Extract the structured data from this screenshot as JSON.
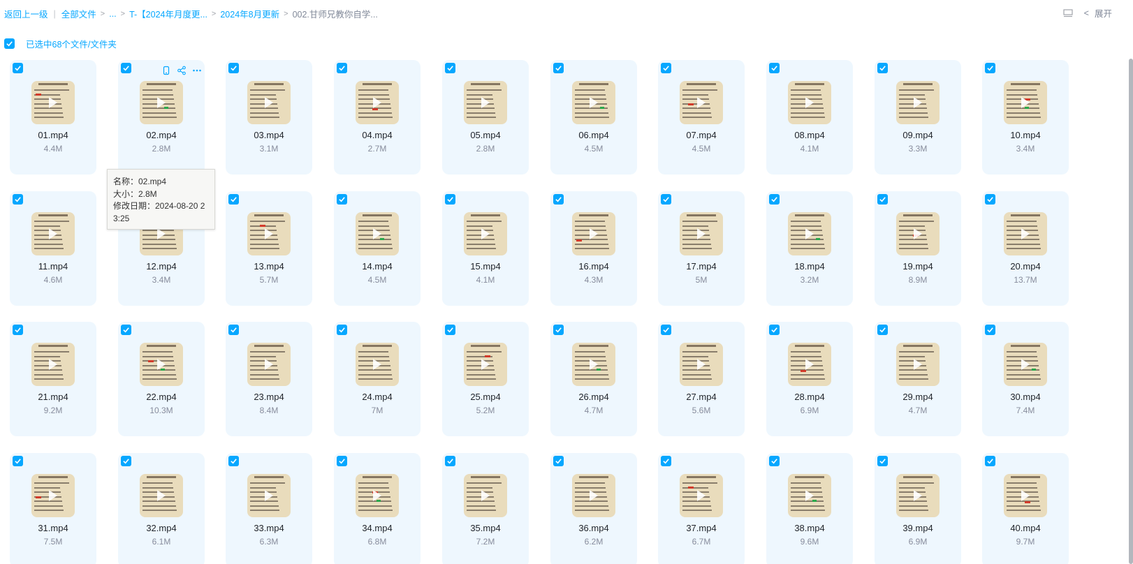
{
  "breadcrumb": {
    "back": "返回上一级",
    "items": [
      "全部文件",
      "...",
      "T-【2024年月度更...",
      "2024年8月更新",
      "002.甘师兄教你自学..."
    ]
  },
  "toolbar": {
    "expand_label": "展开"
  },
  "selection": {
    "label": "已选中68个文件/文件夹",
    "checked": true
  },
  "files": [
    {
      "name": "01.mp4",
      "size": "4.4M"
    },
    {
      "name": "02.mp4",
      "size": "2.8M"
    },
    {
      "name": "03.mp4",
      "size": "3.1M"
    },
    {
      "name": "04.mp4",
      "size": "2.7M"
    },
    {
      "name": "05.mp4",
      "size": "2.8M"
    },
    {
      "name": "06.mp4",
      "size": "4.5M"
    },
    {
      "name": "07.mp4",
      "size": "4.5M"
    },
    {
      "name": "08.mp4",
      "size": "4.1M"
    },
    {
      "name": "09.mp4",
      "size": "3.3M"
    },
    {
      "name": "10.mp4",
      "size": "3.4M"
    },
    {
      "name": "11.mp4",
      "size": "4.6M"
    },
    {
      "name": "12.mp4",
      "size": "3.4M"
    },
    {
      "name": "13.mp4",
      "size": "5.7M"
    },
    {
      "name": "14.mp4",
      "size": "4.5M"
    },
    {
      "name": "15.mp4",
      "size": "4.1M"
    },
    {
      "name": "16.mp4",
      "size": "4.3M"
    },
    {
      "name": "17.mp4",
      "size": "5M"
    },
    {
      "name": "18.mp4",
      "size": "3.2M"
    },
    {
      "name": "19.mp4",
      "size": "8.9M"
    },
    {
      "name": "20.mp4",
      "size": "13.7M"
    },
    {
      "name": "21.mp4",
      "size": "9.2M"
    },
    {
      "name": "22.mp4",
      "size": "10.3M"
    },
    {
      "name": "23.mp4",
      "size": "8.4M"
    },
    {
      "name": "24.mp4",
      "size": "7M"
    },
    {
      "name": "25.mp4",
      "size": "5.2M"
    },
    {
      "name": "26.mp4",
      "size": "4.7M"
    },
    {
      "name": "27.mp4",
      "size": "5.6M"
    },
    {
      "name": "28.mp4",
      "size": "6.9M"
    },
    {
      "name": "29.mp4",
      "size": "4.7M"
    },
    {
      "name": "30.mp4",
      "size": "7.4M"
    },
    {
      "name": "31.mp4",
      "size": "7.5M"
    },
    {
      "name": "32.mp4",
      "size": "6.1M"
    },
    {
      "name": "33.mp4",
      "size": "6.3M"
    },
    {
      "name": "34.mp4",
      "size": "6.8M"
    },
    {
      "name": "35.mp4",
      "size": "7.2M"
    },
    {
      "name": "36.mp4",
      "size": "6.2M"
    },
    {
      "name": "37.mp4",
      "size": "6.7M"
    },
    {
      "name": "38.mp4",
      "size": "9.6M"
    },
    {
      "name": "39.mp4",
      "size": "6.9M"
    },
    {
      "name": "40.mp4",
      "size": "9.7M"
    }
  ],
  "tooltip": {
    "name_line": "名称：02.mp4",
    "size_line": "大小：2.8M",
    "date_line": "修改日期：2024-08-20 23:25"
  },
  "colors": {
    "accent": "#06a7ff",
    "card_bg": "#eef7fe",
    "thumb_bg": "#e9dcbc"
  },
  "icons": {
    "checkbox": "check-icon",
    "phone": "phone-icon",
    "share": "share-icon",
    "more": "more-icon",
    "panel": "panel-icon",
    "back": "chevron-left-icon"
  }
}
